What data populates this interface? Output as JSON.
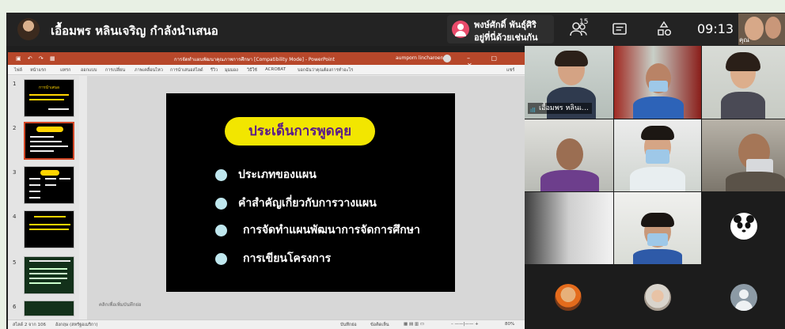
{
  "topbar": {
    "presenter_title": "เอื้อมพร หลินเจริญ กำลังนำเสนอ",
    "speaker_line1": "พงษ์ศักดิ์ พันธุ์ศิริ",
    "speaker_line2": "อยู่ที่นี่ด้วยเช่นกัน",
    "participant_count": "15",
    "time": "09:13",
    "self_label": "คุณ",
    "icons": [
      "people-icon",
      "chat-icon",
      "activities-icon"
    ]
  },
  "powerpoint": {
    "window_title": "การจัดทำแผนพัฒนาคุณภาพการศึกษา [Compatibility Mode] - PowerPoint",
    "user_name": "aumporn lincharoen",
    "user_initials": "AL",
    "ribbon_tabs": [
      "ไฟล์",
      "หน้าแรก",
      "แทรก",
      "ออกแบบ",
      "การเปลี่ยน",
      "ภาพเคลื่อนไหว",
      "การนำเสนอสไลด์",
      "รีวิว",
      "มุมมอง",
      "วิธีใช้",
      "ACROBAT",
      "บอกฉันว่าคุณต้องการทำอะไร",
      "แชร์"
    ],
    "slide_numbers": [
      "1",
      "2",
      "3",
      "4",
      "5",
      "6"
    ],
    "thumb1_title": "การนำเสนอ",
    "thumb2_title": "ประเด็นการพูดคุย",
    "thumb3_title": "คำนำ",
    "notes_placeholder": "คลิกเพื่อเพิ่มบันทึกย่อ",
    "status_left": "สไลด์ 2 จาก 106",
    "status_lang": "อังกฤษ (สหรัฐอเมริกา)",
    "status_notes": "บันทึกย่อ",
    "status_comments": "ข้อคิดเห็น",
    "zoom": "80%"
  },
  "slide": {
    "title": "ประเด็นการพูดคุย",
    "bullets": [
      "ประเภทของแผน",
      "คำสำคัญเกี่ยวกับการวางแผน",
      "การจัดทำแผนพัฒนาการจัดการศึกษา",
      "การเขียนโครงการ"
    ]
  },
  "video": {
    "active_speaker_tag": "เอื้อมพร หลินเ..."
  },
  "colors": {
    "accent": "#2fb4ff",
    "ppt_brand": "#b7472a",
    "slide_title_pill": "#f2e600",
    "slide_title_text": "#5a1a8a",
    "bullet_dot": "#bfe7ee"
  }
}
